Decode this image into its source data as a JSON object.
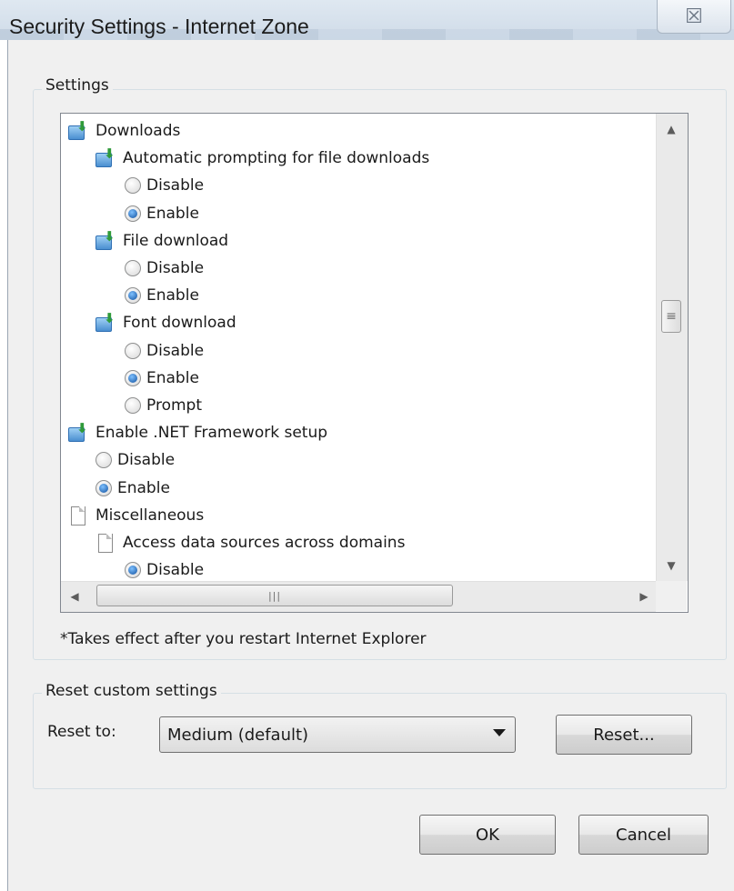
{
  "window": {
    "title": "Security Settings - Internet Zone",
    "close_glyph": "☒"
  },
  "settings": {
    "group_label": "Settings",
    "tree": [
      {
        "label": "Downloads",
        "icon": "download-icon",
        "level": 0
      },
      {
        "label": "Automatic prompting for file downloads",
        "icon": "download-icon",
        "level": 1
      },
      {
        "label": "Disable",
        "radio": true,
        "checked": false,
        "level": 2
      },
      {
        "label": "Enable",
        "radio": true,
        "checked": true,
        "level": 2
      },
      {
        "label": "File download",
        "icon": "download-icon",
        "level": 1
      },
      {
        "label": "Disable",
        "radio": true,
        "checked": false,
        "level": 2
      },
      {
        "label": "Enable",
        "radio": true,
        "checked": true,
        "level": 2
      },
      {
        "label": "Font download",
        "icon": "download-icon",
        "level": 1
      },
      {
        "label": "Disable",
        "radio": true,
        "checked": false,
        "level": 2
      },
      {
        "label": "Enable",
        "radio": true,
        "checked": true,
        "level": 2
      },
      {
        "label": "Prompt",
        "radio": true,
        "checked": false,
        "level": 2
      },
      {
        "label": "Enable .NET Framework setup",
        "icon": "download-icon",
        "level": 0
      },
      {
        "label": "Disable",
        "radio": true,
        "checked": false,
        "level": 1
      },
      {
        "label": "Enable",
        "radio": true,
        "checked": true,
        "level": 1
      },
      {
        "label": "Miscellaneous",
        "icon": "page-icon",
        "level": 0
      },
      {
        "label": "Access data sources across domains",
        "icon": "page-icon",
        "level": 1
      },
      {
        "label": "Disable",
        "radio": true,
        "checked": true,
        "level": 2
      }
    ],
    "note": "*Takes effect after you restart Internet Explorer"
  },
  "reset_group": {
    "group_label": "Reset custom settings",
    "reset_to_label": "Reset to:",
    "selected": "Medium (default)",
    "reset_button": "Reset..."
  },
  "footer": {
    "ok_button": "OK",
    "cancel_button": "Cancel"
  },
  "colors": {
    "dialog_bg": "#f0f0f0",
    "selected_radio": "#0f4f9e",
    "download_arrow": "#2f9a3a"
  }
}
